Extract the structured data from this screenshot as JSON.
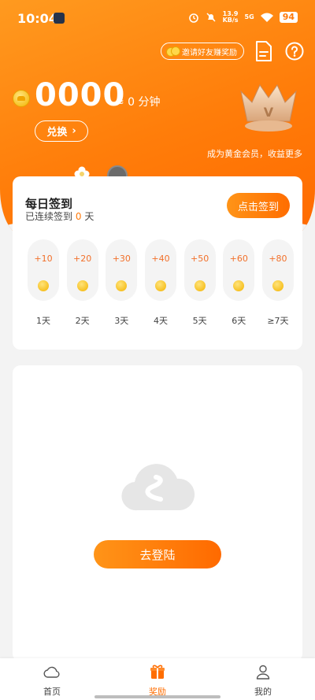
{
  "status": {
    "time": "10:04",
    "speed_top": "13.9",
    "speed_bottom": "KB/s",
    "net": "5G",
    "battery": "94"
  },
  "header": {
    "invite_label": "邀请好友赚奖励"
  },
  "balance": {
    "amount": "0000",
    "minutes": "≈ 0 分钟",
    "exchange_label": "兑换",
    "exchange_arrow": "›"
  },
  "vip": {
    "tip": "成为黄金会员，收益更多",
    "crown_letter": "V"
  },
  "checkin": {
    "title": "每日签到",
    "streak_prefix": "已连续签到",
    "streak_days": "0",
    "streak_suffix": "天",
    "button_label": "点击签到",
    "days": [
      {
        "reward": "+10",
        "label": "1天"
      },
      {
        "reward": "+20",
        "label": "2天"
      },
      {
        "reward": "+30",
        "label": "3天"
      },
      {
        "reward": "+40",
        "label": "4天"
      },
      {
        "reward": "+50",
        "label": "5天"
      },
      {
        "reward": "+60",
        "label": "6天"
      },
      {
        "reward": "+80",
        "label": "≥7天"
      }
    ]
  },
  "login": {
    "button_label": "去登陆"
  },
  "tabbar": {
    "tabs": [
      {
        "label": "首页",
        "icon": "cloud-icon"
      },
      {
        "label": "奖励",
        "icon": "gift-icon"
      },
      {
        "label": "我的",
        "icon": "person-icon"
      }
    ]
  },
  "colors": {
    "accent": "#ff7a0a",
    "accent_dark": "#ff6a00",
    "reward_text": "#f2702a"
  }
}
